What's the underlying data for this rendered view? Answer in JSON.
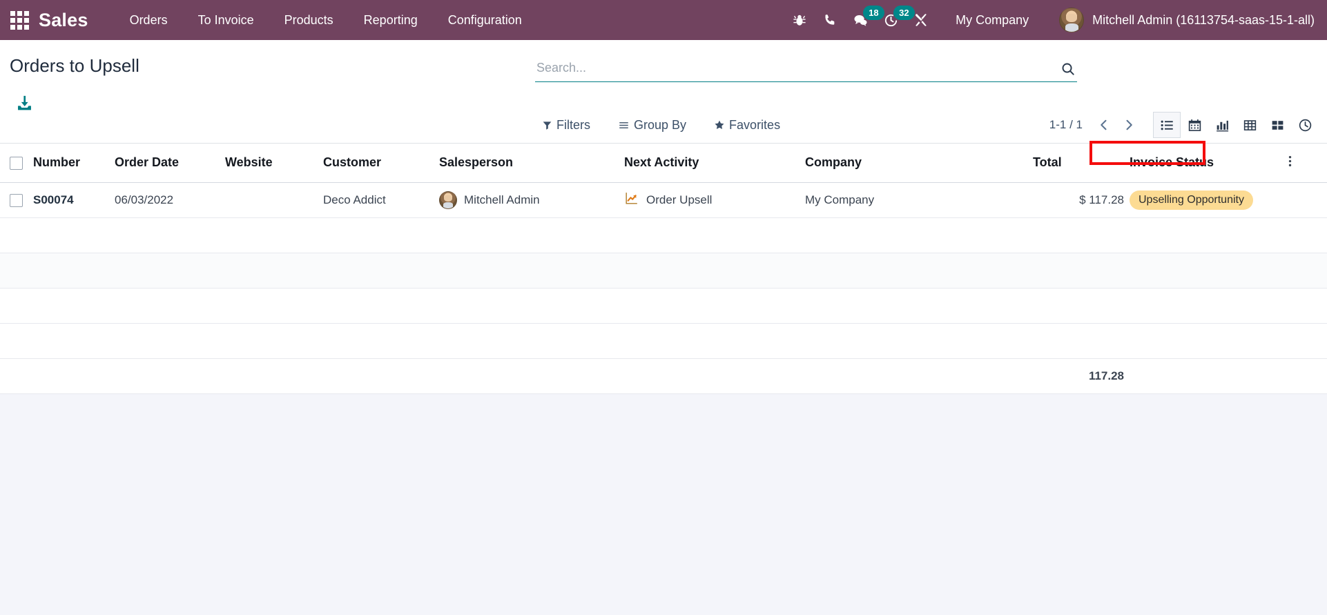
{
  "navbar": {
    "apps_icon": "apps-grid-icon",
    "brand": "Sales",
    "menu": [
      {
        "label": "Orders"
      },
      {
        "label": "To Invoice"
      },
      {
        "label": "Products"
      },
      {
        "label": "Reporting"
      },
      {
        "label": "Configuration"
      }
    ],
    "sys_icons": [
      {
        "name": "bug-icon",
        "badge": ""
      },
      {
        "name": "phone-icon",
        "badge": ""
      },
      {
        "name": "messages-icon",
        "badge": "18"
      },
      {
        "name": "activities-clock-icon",
        "badge": "32"
      },
      {
        "name": "tools-icon",
        "badge": ""
      }
    ],
    "company": "My Company",
    "user": "Mitchell Admin (16113754-saas-15-1-all)",
    "bg_color": "#71435f",
    "badge_color": "#00878a"
  },
  "control_panel": {
    "title": "Orders to Upsell",
    "download_icon": "download-import-icon",
    "search": {
      "placeholder": "Search...",
      "value": "",
      "icon": "search-icon",
      "underline_color": "#017e84"
    },
    "filters": [
      {
        "label": "Filters",
        "icon": "funnel-icon"
      },
      {
        "label": "Group By",
        "icon": "bars-icon"
      },
      {
        "label": "Favorites",
        "icon": "star-icon"
      }
    ],
    "pager": {
      "range": "1-1 / 1",
      "prev_icon": "chevron-left-icon",
      "next_icon": "chevron-right-icon"
    },
    "views": [
      {
        "name": "list-view",
        "icon": "list-icon",
        "active": true
      },
      {
        "name": "calendar-view",
        "icon": "calendar-icon",
        "active": false
      },
      {
        "name": "graph-view",
        "icon": "bar-chart-icon",
        "active": false
      },
      {
        "name": "pivot-view",
        "icon": "pivot-table-icon",
        "active": false
      },
      {
        "name": "kanban-view",
        "icon": "kanban-icon",
        "active": false
      },
      {
        "name": "activity-view",
        "icon": "clock-icon",
        "active": false
      }
    ]
  },
  "table": {
    "headers": [
      "Number",
      "Order Date",
      "Website",
      "Customer",
      "Salesperson",
      "Next Activity",
      "Company",
      "Total",
      "Invoice Status"
    ],
    "optional_columns_icon": "vertical-dots-icon",
    "rows": [
      {
        "number": "S00074",
        "order_date": "06/03/2022",
        "website": "",
        "customer": "Deco Addict",
        "salesperson": "Mitchell Admin",
        "salesperson_avatar": "avatar",
        "next_activity": "Order Upsell",
        "next_activity_icon": "trending-up-icon",
        "company": "My Company",
        "total": "$ 117.28",
        "invoice_status": "Upselling Opportunity"
      }
    ],
    "footer_total": "117.28",
    "badge_bg": "#fcdb93"
  },
  "annotation": {
    "target": "Invoice Status",
    "color": "#f40d0d"
  }
}
